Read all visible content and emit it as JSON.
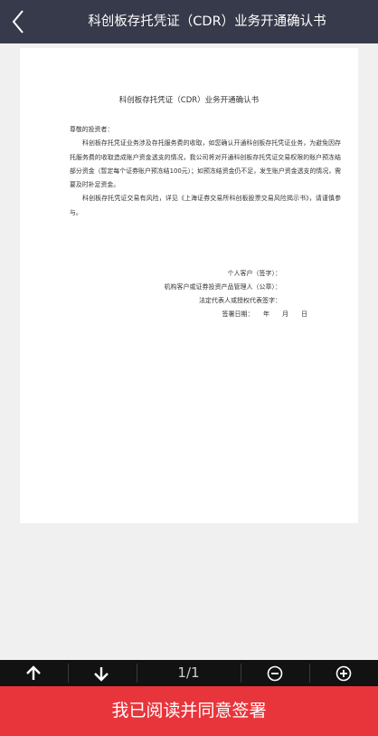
{
  "header": {
    "title": "科创板存托凭证（CDR）业务开通确认书",
    "back_icon": "chevron-left-icon"
  },
  "document": {
    "title": "科创板存托凭证（CDR）业务开通确认书",
    "salutation": "尊敬的投资者：",
    "paragraphs": [
      "科创板存托凭证业务涉及存托服务费的收取，如您确认开通科创板存托凭证业务，为避免因存托服务费的收取造成账户资金透支的情况，我公司将对开通科创板存托凭证交易权限的账户预冻结部分资金（暂定每个证券账户预冻结100元）；如预冻结资金仍不足，发生账户资金透支的情况，需要及时补足资金。",
      "科创板存托凭证交易有风险，详见《上海证券交易所科创板股票交易风险揭示书》，请谨慎参与。"
    ],
    "signatures": {
      "individual": "个人客户（签字）：",
      "institution": "机构客户或证券投资产品管理人（公章）：",
      "legal_rep": "法定代表人或授权代表签字：",
      "date": "签署日期：　　年　　月　　日"
    }
  },
  "toolbar": {
    "page_indicator": "1/1",
    "prev_icon": "arrow-up-icon",
    "next_icon": "arrow-down-icon",
    "zoom_out_icon": "zoom-out-icon",
    "zoom_in_icon": "zoom-in-icon"
  },
  "footer": {
    "agree_label": "我已阅读并同意签署"
  },
  "colors": {
    "header_bg": "#373a4a",
    "toolbar_bg": "#121212",
    "agree_button": "#e8353b"
  }
}
